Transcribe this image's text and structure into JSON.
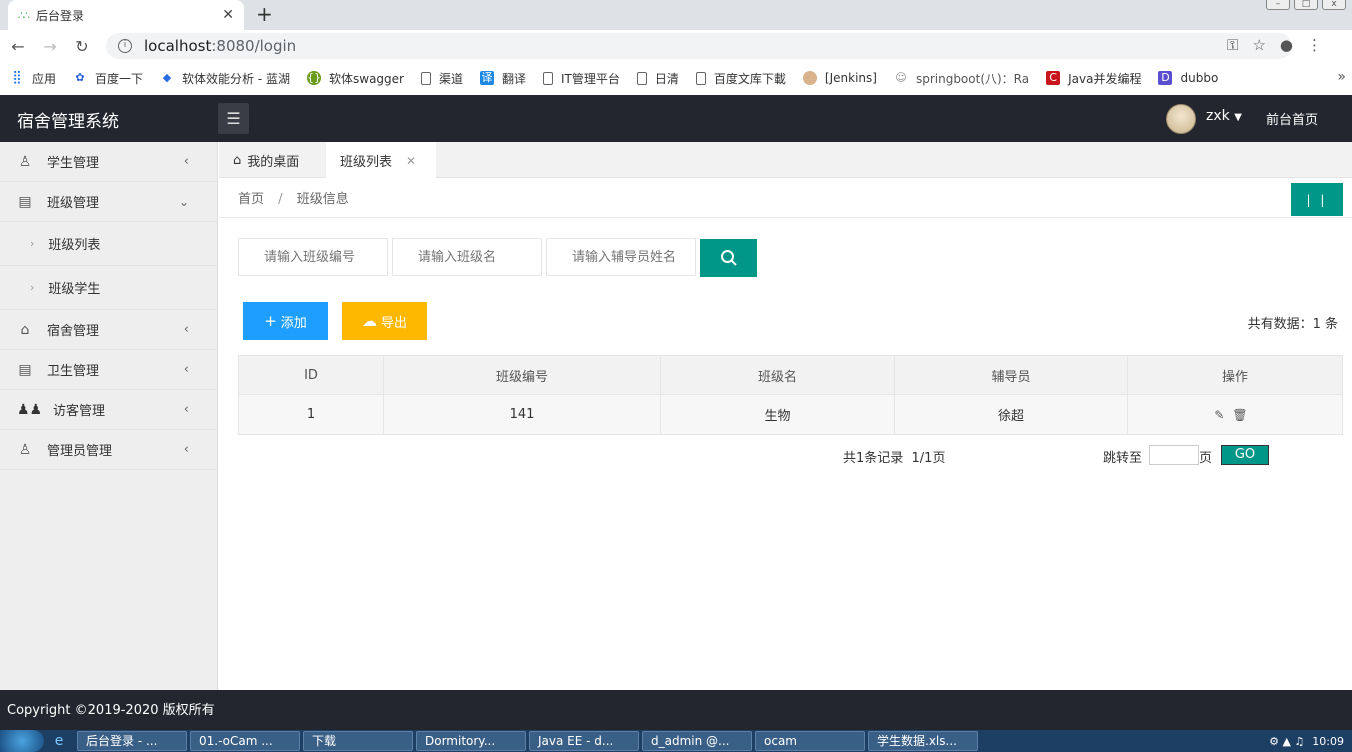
{
  "browser": {
    "tab_title": "后台登录",
    "url_host": "localhost",
    "url_rest": ":8080/login",
    "bookmarks": [
      "应用",
      "百度一下",
      "软体效能分析 - 蓝湖",
      "软体swagger",
      "渠道",
      "翻译",
      "IT管理平台",
      "日清",
      "百度文库下載",
      "[Jenkins]",
      "springboot(八)：Ra"
    ],
    "bookmarks_more": [
      "Java并发编程",
      "dubbo"
    ]
  },
  "header": {
    "logo": "宿舍管理系统",
    "user": "zxk",
    "front_link": "前台首页"
  },
  "sidebar": {
    "student": "学生管理",
    "class": "班级管理",
    "class_list": "班级列表",
    "class_students": "班级学生",
    "dorm": "宿舍管理",
    "hygiene": "卫生管理",
    "visitor": "访客管理",
    "admin": "管理员管理"
  },
  "tabs": {
    "home": "我的桌面",
    "active": "班级列表"
  },
  "breadcrumb": {
    "home": "首页",
    "sep": "/",
    "current": "班级信息"
  },
  "search": {
    "class_no_placeholder": "请输入班级编号",
    "class_name_placeholder": "请输入班级名",
    "counselor_placeholder": "请输入辅导员姓名"
  },
  "toolbar": {
    "add": "添加",
    "export": "导出",
    "total": "共有数据：1 条"
  },
  "table": {
    "headers": [
      "ID",
      "班级编号",
      "班级名",
      "辅导员",
      "操作"
    ],
    "rows": [
      [
        "1",
        "141",
        "生物",
        "徐超"
      ]
    ]
  },
  "pager": {
    "info": "共1条记录  1/1页",
    "jump_label": "跳转至",
    "page_unit": "页",
    "go": "GO"
  },
  "footer": {
    "copyright": "Copyright ©2019-2020 版权所有"
  },
  "taskbar": [
    "后台登录 - ...",
    "01.-oCam ...",
    "下载",
    "Dormitory...",
    "Java EE - d...",
    "d_admin @...",
    "ocam",
    "学生数据.xls..."
  ],
  "clock": "10:09",
  "colors": {
    "header_bg": "#23262e",
    "primary": "#009688",
    "blue": "#1e9fff",
    "orange": "#ffb800"
  }
}
